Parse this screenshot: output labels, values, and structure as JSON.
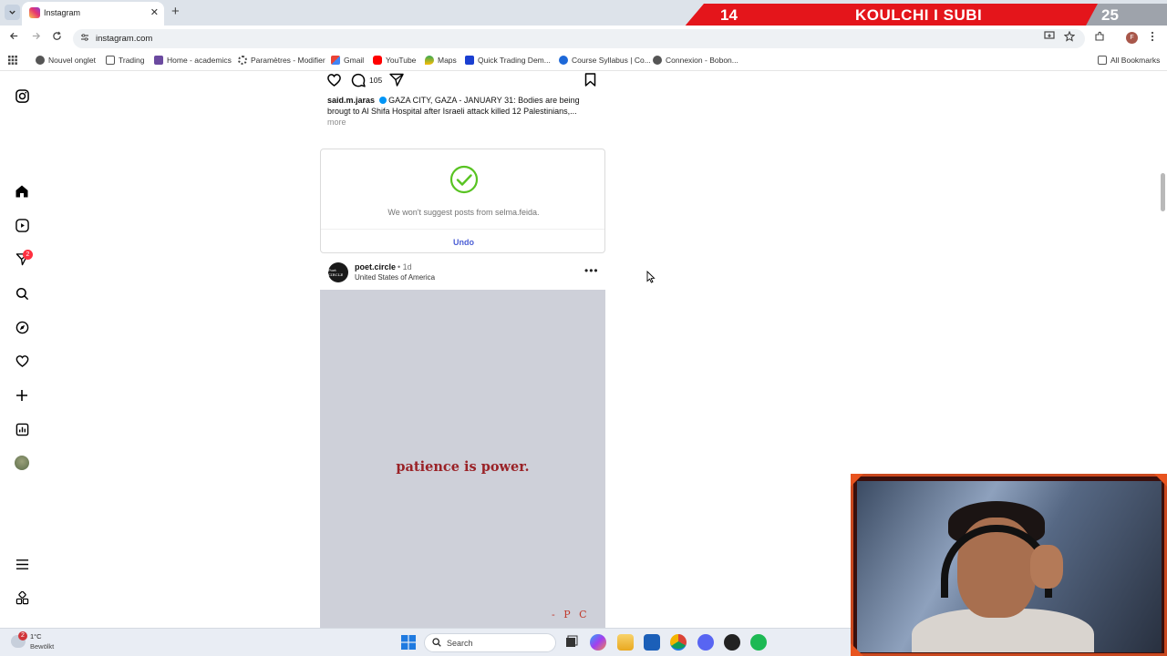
{
  "browser": {
    "tab_title": "Instagram",
    "url": "instagram.com",
    "bookmarks": [
      {
        "label": "Nouvel onglet",
        "icon": "globe-icon"
      },
      {
        "label": "Trading",
        "icon": "folder-icon"
      },
      {
        "label": "Home - academics",
        "icon": "academics-icon"
      },
      {
        "label": "Paramètres - Modifier",
        "icon": "gear-icon"
      },
      {
        "label": "Gmail",
        "icon": "gmail-icon"
      },
      {
        "label": "YouTube",
        "icon": "youtube-icon"
      },
      {
        "label": "Maps",
        "icon": "maps-icon"
      },
      {
        "label": "Quick Trading Dem...",
        "icon": "trading-icon"
      },
      {
        "label": "Course Syllabus | Co...",
        "icon": "course-icon"
      },
      {
        "label": "Connexion - Bobon...",
        "icon": "globe-icon"
      }
    ],
    "all_bookmarks": "All Bookmarks",
    "profile_initial": "F"
  },
  "stream_overlay": {
    "score_left": "14",
    "title": "KOULCHI I SUBI",
    "score_right": "25"
  },
  "instagram": {
    "nav_badge": "2",
    "post_prev": {
      "comment_count": "105",
      "caption_user": "said.m.jaras",
      "caption_text": " GAZA CITY, GAZA - JANUARY 31: Bodies are being brougt to Al Shifa Hospital after Israeli attack killed 12 Palestinians,...",
      "more": "more"
    },
    "suggestion_card": {
      "message": "We won't suggest posts from selma.feida.",
      "undo_label": "Undo"
    },
    "post": {
      "avatar_text": "Poet CIRCLE",
      "username": "poet.circle",
      "time": "• 1d",
      "location": "United States of America",
      "more_label": "•••",
      "quote": "patience is power.",
      "signature": "- P C"
    }
  },
  "taskbar": {
    "weather_badge": "2",
    "temperature": "1°C",
    "weather_desc": "Bewölkt",
    "search_label": "Search"
  },
  "colors": {
    "instagram_link": "#4c5fd5",
    "success_green": "#58c322",
    "overlay_red": "#e4151b",
    "quote_red": "#9a2227"
  }
}
